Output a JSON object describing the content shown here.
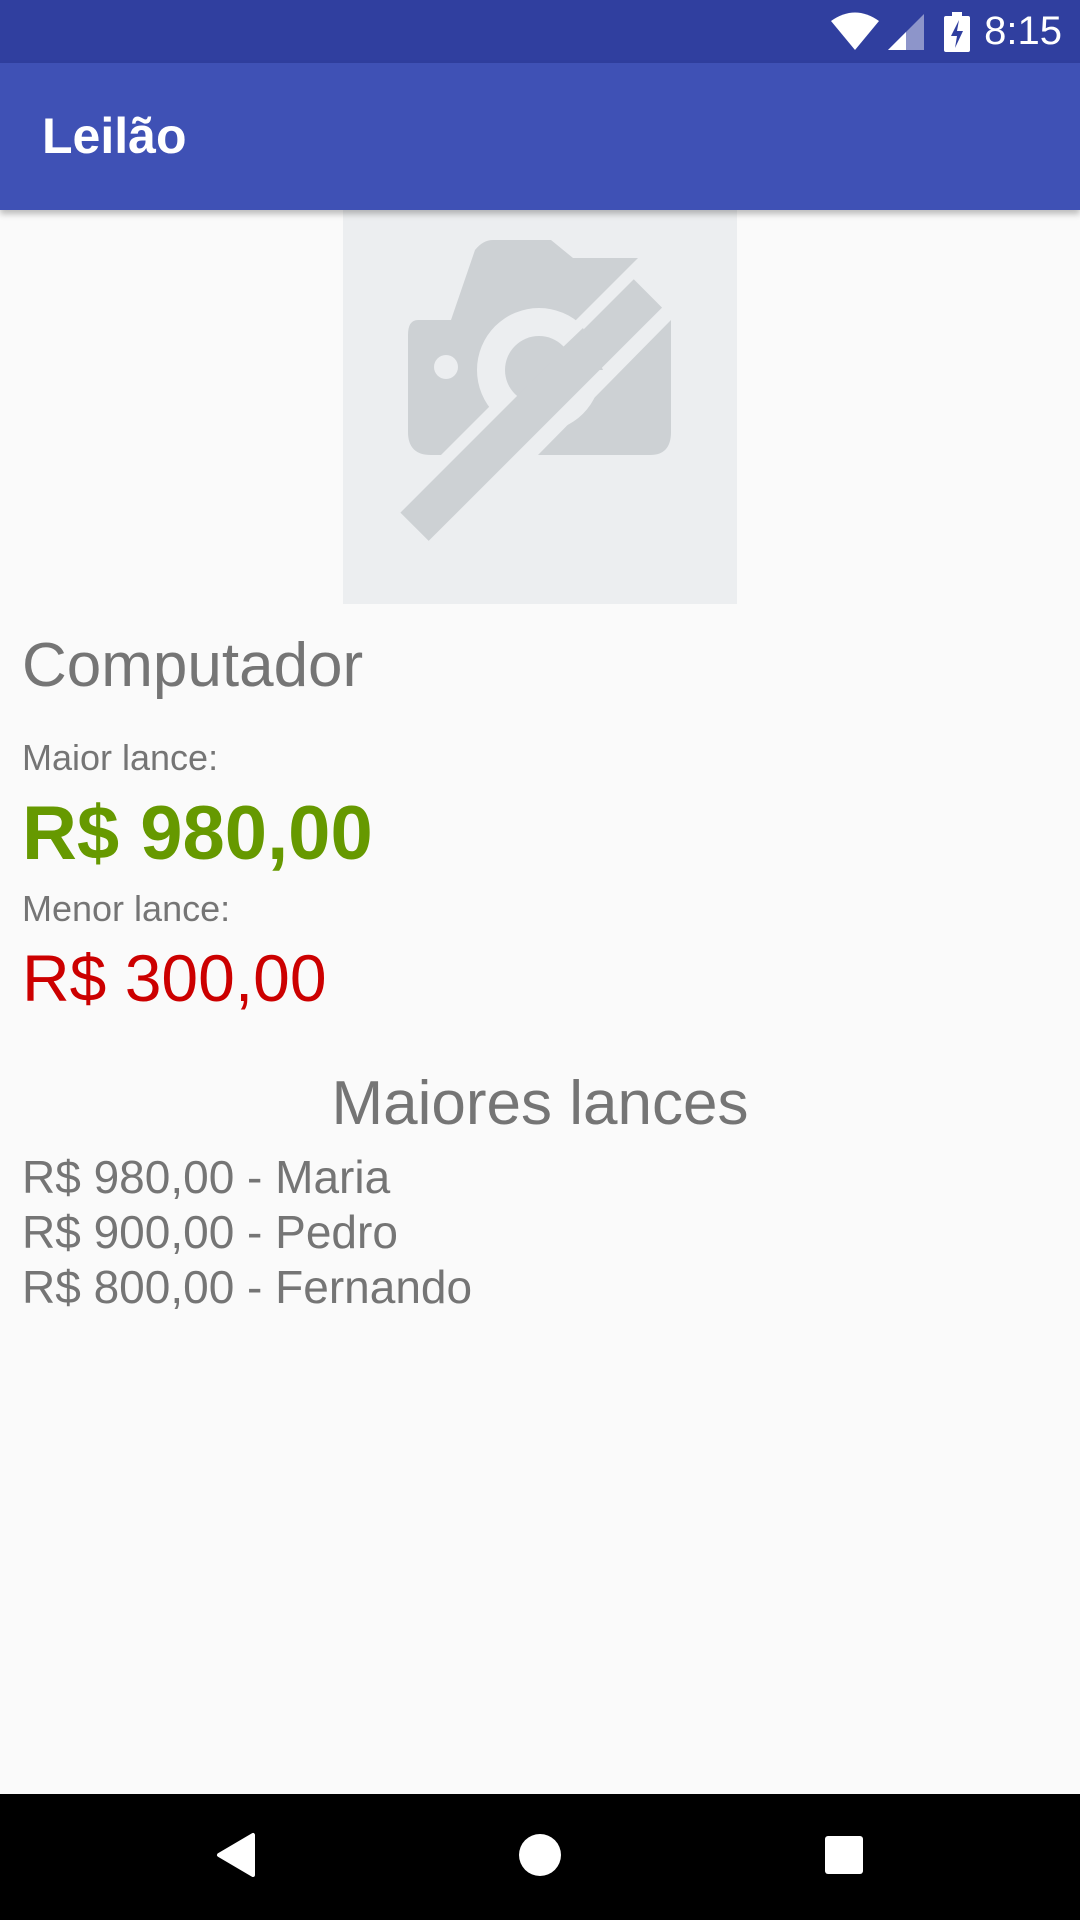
{
  "status_bar": {
    "time": "8:15",
    "icons": [
      "wifi-icon",
      "cell-signal-icon",
      "battery-charging-icon"
    ],
    "color": "#303f9f"
  },
  "app_bar": {
    "title": "Leilão",
    "color": "#3f51b5"
  },
  "product": {
    "image_icon": "no-photo-icon",
    "name": "Computador",
    "highest_label": "Maior lance:",
    "highest_value": "R$ 980,00",
    "highest_color": "#669900",
    "lowest_label": "Menor lance:",
    "lowest_value": "R$ 300,00",
    "lowest_color": "#cc0000"
  },
  "top_bids": {
    "title": "Maiores lances",
    "items": [
      "R$ 980,00 - Maria",
      "R$ 900,00 - Pedro",
      "R$ 800,00 - Fernando"
    ]
  },
  "nav_bar": {
    "icons": [
      "back-icon",
      "home-icon",
      "recent-apps-icon"
    ]
  }
}
